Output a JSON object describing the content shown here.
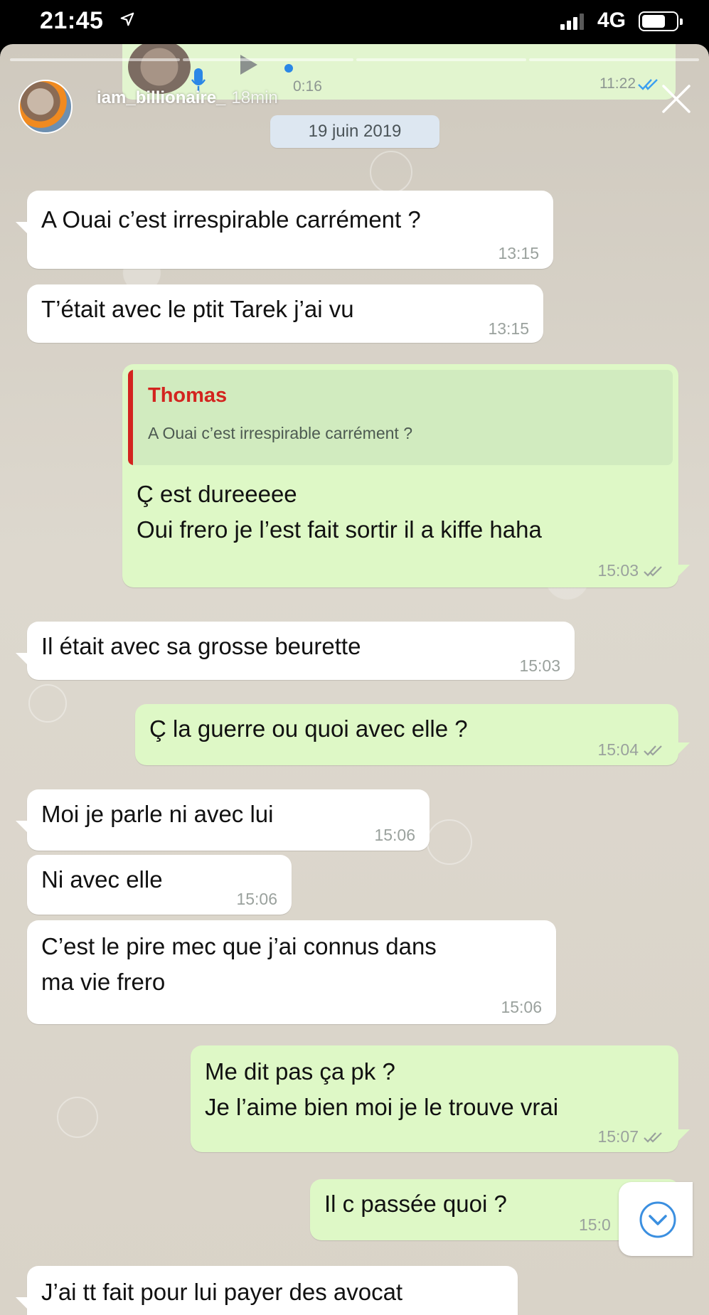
{
  "status_bar": {
    "time": "21:45",
    "network": "4G",
    "battery_level": 0.7,
    "signal_bars": 3
  },
  "story": {
    "username": "iam_billionaire_",
    "posted": "18min",
    "progress_segments": 4
  },
  "voice_message": {
    "duration": "0:16",
    "time": "11:22"
  },
  "date_label": "19 juin 2019",
  "colors": {
    "read_ticks": "#3b9ff0",
    "delivered_ticks": "#9aa19d",
    "quote_accent": "#d3241f",
    "outgoing_bubble": "#def8c6",
    "incoming_bubble": "#ffffff"
  },
  "messages": [
    {
      "dir": "in",
      "text": "A Ouai c’est irrespirable carrément ?",
      "time": "13:15"
    },
    {
      "dir": "in",
      "text": "T’était avec le ptit Tarek j’ai vu",
      "time": "13:15"
    },
    {
      "dir": "out",
      "quote_author": "Thomas",
      "quote_text": "A Ouai c’est irrespirable carrément ?",
      "text": "Ç est dureeeee\nOui frero je l’est fait sortir il a kiffe haha",
      "time": "15:03"
    },
    {
      "dir": "in",
      "text": "Il était avec sa grosse beurette",
      "time": "15:03"
    },
    {
      "dir": "out",
      "text": "Ç la guerre ou quoi avec elle ?",
      "time": "15:04"
    },
    {
      "dir": "in",
      "text": "Moi je parle ni avec lui",
      "time": "15:06"
    },
    {
      "dir": "in",
      "text": "Ni avec elle",
      "time": "15:06"
    },
    {
      "dir": "in",
      "text": "C’est le pire mec que j’ai connus dans\nma vie frero",
      "time": "15:06"
    },
    {
      "dir": "out",
      "text": "Me dit pas ça pk ?\nJe l’aime bien moi je le trouve vrai",
      "time": "15:07"
    },
    {
      "dir": "out",
      "text": "Il c passée quoi ?",
      "time": "15:0"
    },
    {
      "dir": "in",
      "text": "J’ai tt fait pour lui payer des avocat",
      "time": ""
    }
  ]
}
